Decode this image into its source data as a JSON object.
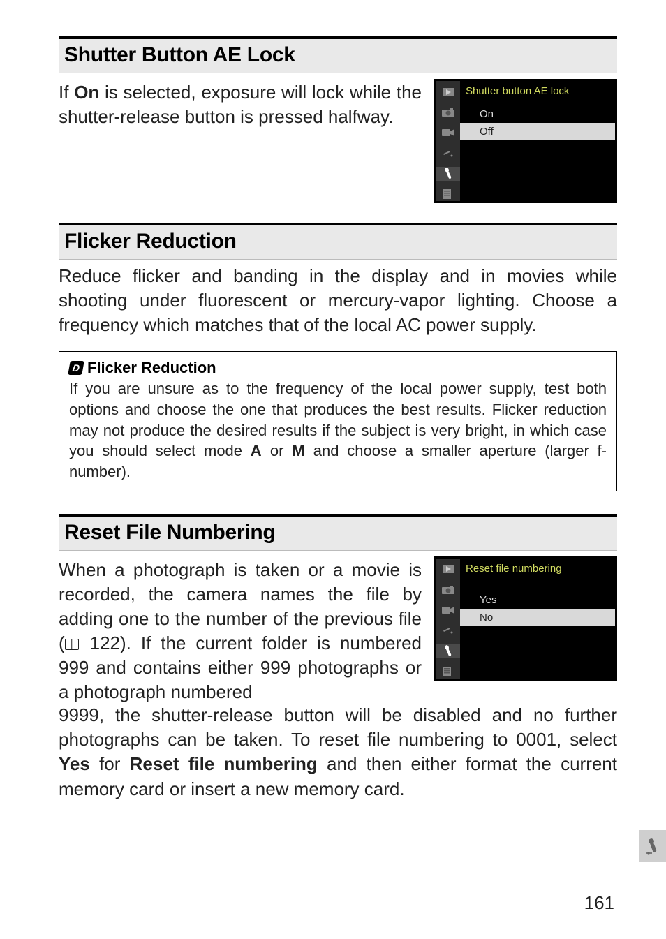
{
  "sections": [
    {
      "heading": "Shutter Button AE Lock",
      "body_parts": [
        "If ",
        "On",
        " is selected, exposure will lock while the shutter-release button is pressed halfway."
      ],
      "lcd": {
        "title": "Shutter button AE lock",
        "options": [
          "On",
          "Off"
        ],
        "selected_index": 1
      }
    },
    {
      "heading": "Flicker Reduction",
      "body": "Reduce flicker and banding in the display and in movies while shooting under fluorescent or mercury-vapor lighting. Choose a frequency which matches that of the local AC power supply.",
      "note": {
        "title": "Flicker Reduction",
        "body_parts": [
          "If you are unsure as to the frequency of the local power supply, test both options and choose the one that produces the best results. Flicker reduction may not produce the desired results if the subject is very bright, in which case you should select mode ",
          "A",
          " or ",
          "M",
          " and choose a smaller aperture (larger f-number)."
        ]
      }
    },
    {
      "heading": "Reset File Numbering",
      "body_parts_top": [
        "When a photograph is taken or a movie is recorded, the camera names the file by adding one to the number of the previous file (",
        "122",
        "). If the current folder is numbered 999 and contains either 999 photographs or a photograph numbered"
      ],
      "body_bottom_parts": [
        "9999, the shutter-release button will be disabled and no further photographs can be taken. To reset file numbering to 0001, select ",
        "Yes",
        " for ",
        "Reset file numbering",
        " and then either format the current memory card or insert a new memory card."
      ],
      "lcd": {
        "title": "Reset file numbering",
        "options": [
          "Yes",
          "No"
        ],
        "selected_index": 1
      }
    }
  ],
  "side_icons": {
    "playback": "play-icon",
    "camera": "camera-icon",
    "movie": "movie-icon",
    "retouch": "retouch-icon",
    "setup": "wrench-icon",
    "recent": "recent-icon"
  },
  "thumb_tab_icon": "wrench-icon",
  "page_number": "161"
}
